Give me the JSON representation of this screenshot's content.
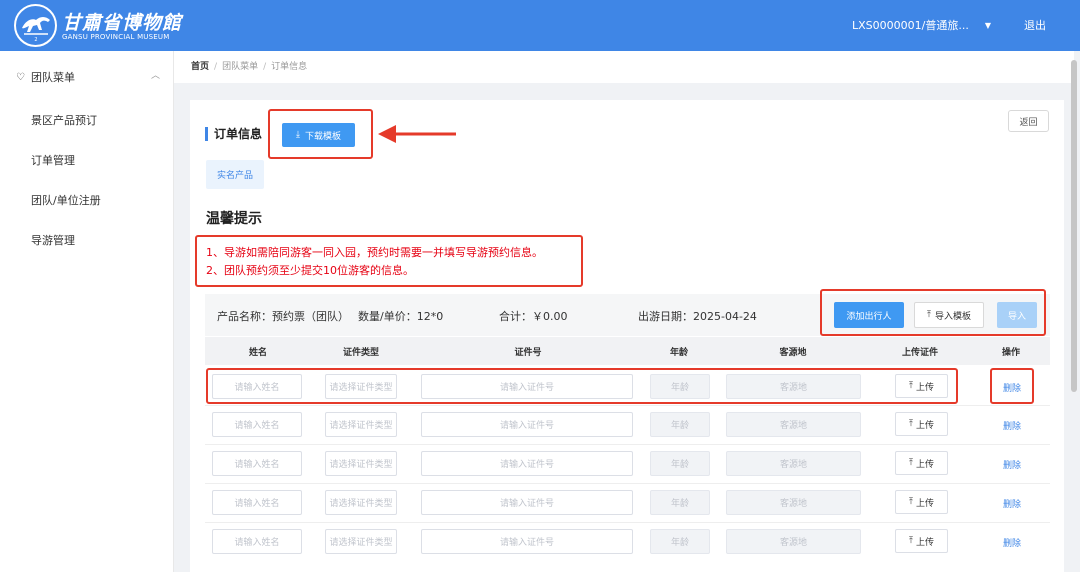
{
  "header": {
    "logo_title": "甘肅省博物館",
    "logo_subtitle": "GANSU PROVINCIAL MUSEUM",
    "user_label": "LXS0000001/普通旅...",
    "logout_label": "退出",
    "brand_color": "#3f86e6"
  },
  "sidebar": {
    "group_label": "团队菜单",
    "items": [
      {
        "label": "景区产品预订"
      },
      {
        "label": "订单管理"
      },
      {
        "label": "团队/单位注册"
      },
      {
        "label": "导游管理"
      }
    ]
  },
  "breadcrumb": [
    "首页",
    "团队菜单",
    "订单信息"
  ],
  "order": {
    "section_title": "订单信息",
    "download_label": "下载模板",
    "return_label": "返回",
    "product_tag": "实名产品"
  },
  "tips": {
    "title": "温馨提示",
    "lines": [
      "1、导游如需陪同游客一同入园，预约时需要一并填写导游预约信息。",
      "2、团队预约须至少提交10位游客的信息。"
    ]
  },
  "product_bar": {
    "name": "产品名称：预约票（团队）",
    "qty": "数量/单价：12*0",
    "total": "合计：￥0.00",
    "date": "出游日期：2025-04-24",
    "add_label": "添加出行人",
    "import_tpl_label": "导入模板",
    "import_label": "导入"
  },
  "table": {
    "headers": [
      "姓名",
      "证件类型",
      "证件号",
      "年龄",
      "客源地",
      "上传证件",
      "操作"
    ],
    "placeholders": {
      "name": "请输入姓名",
      "id_type": "请选择证件类型",
      "id_no": "请输入证件号",
      "age": "年龄",
      "origin": "客源地"
    },
    "upload_label": "上传",
    "delete_label": "删除",
    "row_count": 5
  }
}
